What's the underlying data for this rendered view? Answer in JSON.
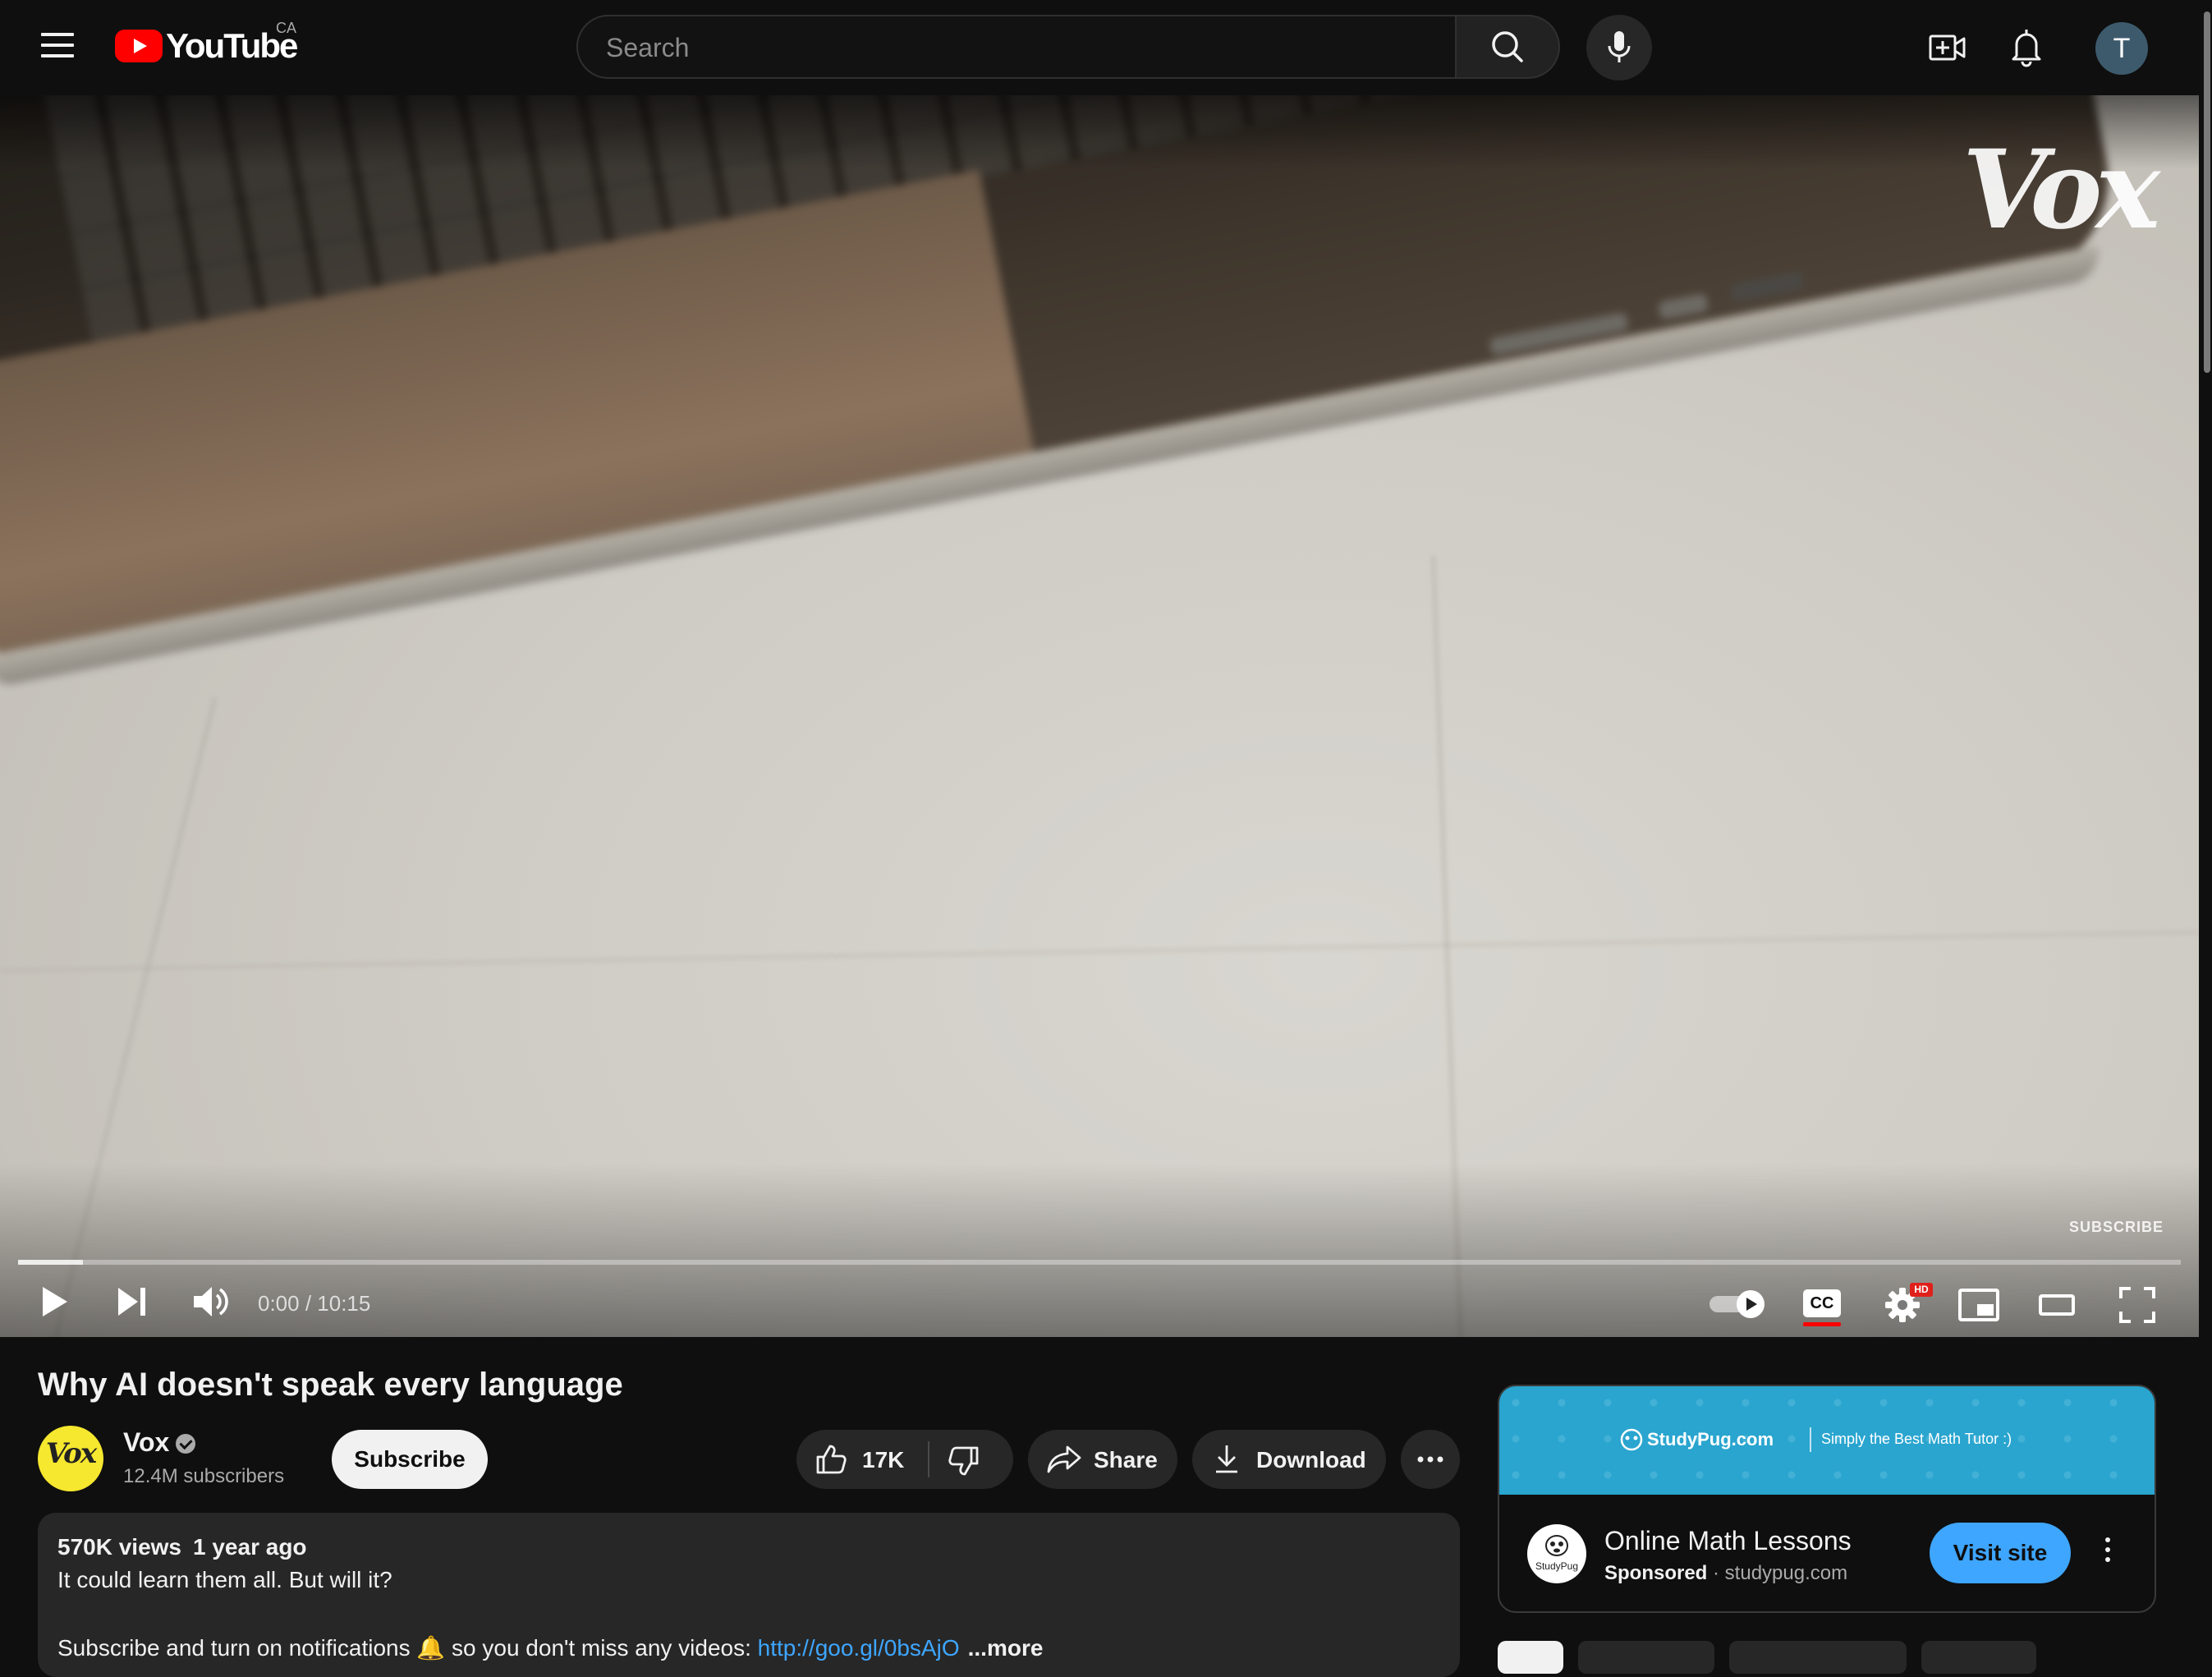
{
  "header": {
    "logo_text": "YouTube",
    "region": "CA",
    "search_placeholder": "Search",
    "avatar_letter": "T"
  },
  "player": {
    "watermark": "Vox",
    "endscreen_subscribe": "SUBSCRIBE",
    "time_current": "0:00",
    "time_total": "10:15",
    "time_separator": " / ",
    "cc_label": "CC",
    "hd_badge": "HD",
    "buffered_fraction": 0.03,
    "played_fraction": 0
  },
  "video": {
    "title": "Why AI doesn't speak every language",
    "channel_name": "Vox",
    "channel_avatar_text": "Vox",
    "subscribers": "12.4M subscribers",
    "subscribe_label": "Subscribe",
    "like_count": "17K",
    "share_label": "Share",
    "download_label": "Download"
  },
  "description": {
    "views": "570K views",
    "age": "1 year ago",
    "line1": "It could learn them all. But will it?",
    "line2_prefix": "Subscribe and turn on notifications 🔔 so you don't miss any videos: ",
    "line2_link": "http://goo.gl/0bsAjO",
    "more": "...more"
  },
  "ad": {
    "banner_brand": "StudyPug.com",
    "banner_tagline": "Simply the Best Math Tutor :)",
    "logo_text": "StudyPug",
    "title": "Online Math Lessons",
    "sponsored": "Sponsored",
    "separator": " · ",
    "domain": "studypug.com",
    "visit_label": "Visit site"
  },
  "colors": {
    "background": "#0f0f0f",
    "brand_red": "#ff0000",
    "ad_blue": "#3ea6ff",
    "chip_bg": "#272727"
  },
  "icons": [
    "menu-icon",
    "youtube-logo-icon",
    "search-icon",
    "mic-icon",
    "create-video-icon",
    "bell-icon",
    "play-icon",
    "next-icon",
    "volume-icon",
    "autoplay-toggle-icon",
    "captions-icon",
    "settings-icon",
    "miniplayer-icon",
    "theater-icon",
    "fullscreen-icon",
    "verified-icon",
    "like-icon",
    "dislike-icon",
    "share-icon",
    "download-icon",
    "more-icon",
    "pug-logo-icon"
  ]
}
